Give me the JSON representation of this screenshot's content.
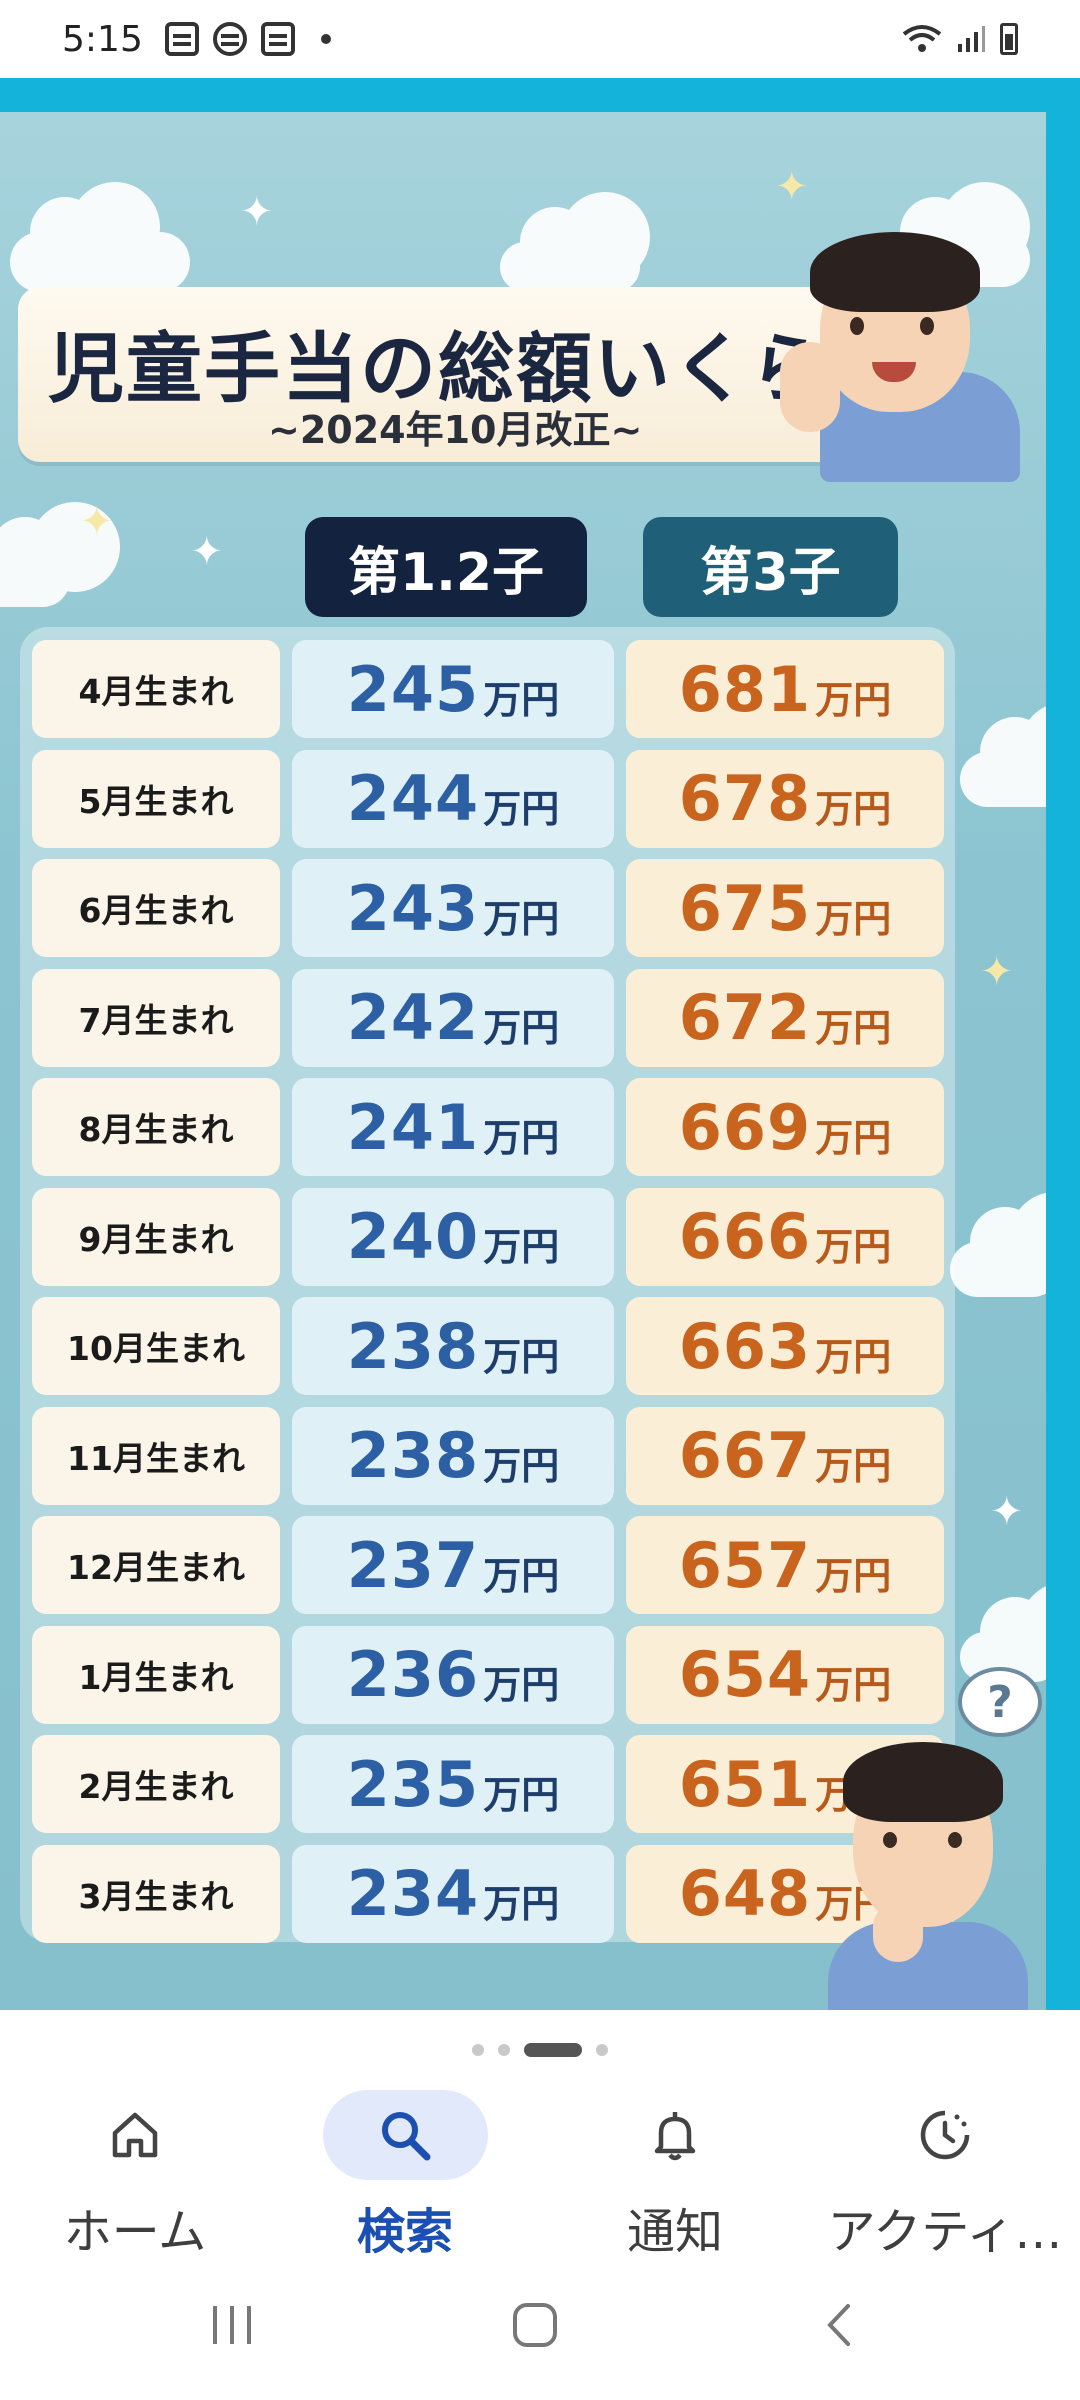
{
  "status_bar": {
    "time": "5:15"
  },
  "poster": {
    "title": "児童手当の総額いくら",
    "subtitle": "~2024年10月改正~",
    "col_1_2": "第1.2子",
    "col_3": "第3子",
    "unit": "万円",
    "rows": [
      {
        "month": "4月生まれ",
        "first_second": "245",
        "third": "681"
      },
      {
        "month": "5月生まれ",
        "first_second": "244",
        "third": "678"
      },
      {
        "month": "6月生まれ",
        "first_second": "243",
        "third": "675"
      },
      {
        "month": "7月生まれ",
        "first_second": "242",
        "third": "672"
      },
      {
        "month": "8月生まれ",
        "first_second": "241",
        "third": "669"
      },
      {
        "month": "9月生まれ",
        "first_second": "240",
        "third": "666"
      },
      {
        "month": "10月生まれ",
        "first_second": "238",
        "third": "663"
      },
      {
        "month": "11月生まれ",
        "first_second": "238",
        "third": "667"
      },
      {
        "month": "12月生まれ",
        "first_second": "237",
        "third": "657"
      },
      {
        "month": "1月生まれ",
        "first_second": "236",
        "third": "654"
      },
      {
        "month": "2月生まれ",
        "first_second": "235",
        "third": "651"
      },
      {
        "month": "3月生まれ",
        "first_second": "234",
        "third": "648"
      }
    ],
    "thought_mark": "?"
  },
  "pager": {
    "count": 4,
    "active": 2
  },
  "bottom_nav": [
    {
      "label": "ホーム",
      "icon": "home-icon",
      "active": false
    },
    {
      "label": "検索",
      "icon": "search-icon",
      "active": true
    },
    {
      "label": "通知",
      "icon": "bell-icon",
      "active": false
    },
    {
      "label": "アクティ…",
      "icon": "activity-icon",
      "active": false
    }
  ],
  "colors": {
    "accent": "#1b4fb1",
    "frame": "#14b4da",
    "blue_number": "#2c5fa3",
    "orange_number": "#c8641e"
  }
}
